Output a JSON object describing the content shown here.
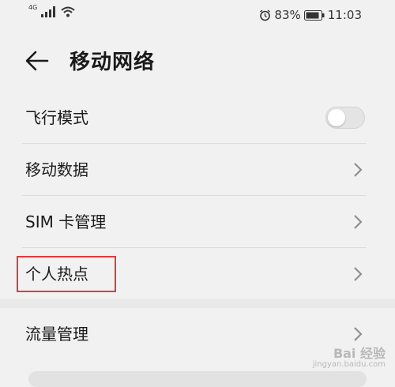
{
  "status_bar": {
    "network_type": "4G",
    "battery_percent": "83%",
    "time": "11:03"
  },
  "header": {
    "title": "移动网络"
  },
  "settings": {
    "items": [
      {
        "label": "飞行模式",
        "control": "toggle",
        "toggle_on": false
      },
      {
        "label": "移动数据",
        "control": "chevron"
      },
      {
        "label": "SIM 卡管理",
        "control": "chevron"
      },
      {
        "label": "个人热点",
        "control": "chevron",
        "highlighted": true
      }
    ],
    "section2": [
      {
        "label": "流量管理",
        "control": "chevron"
      }
    ]
  },
  "watermark": {
    "brand": "Bai 经验",
    "url": "jingyan.baidu.com"
  },
  "colors": {
    "highlight_border": "#e23a3a",
    "background": "#f1f1f1",
    "divider": "#dcdcdc"
  }
}
